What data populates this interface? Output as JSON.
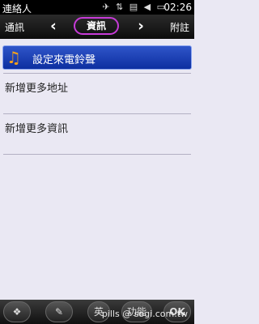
{
  "statusbar": {
    "title": "連絡人",
    "icons": "✈ ⇅ ▤ ◀ ▭",
    "time": "02:26"
  },
  "tabs": {
    "left": "通訊",
    "active": "資訊",
    "right": "附註"
  },
  "list": {
    "selected": {
      "label": "設定來電鈴聲",
      "icon": "music-note-icon"
    },
    "items": [
      "新增更多地址",
      "新增更多資訊"
    ]
  },
  "bottombar": {
    "start": "❖",
    "notes": "✎",
    "eng": "英",
    "mid": "功能",
    "ok": "OK"
  },
  "watermark": "pills @ sogi.com.tw"
}
